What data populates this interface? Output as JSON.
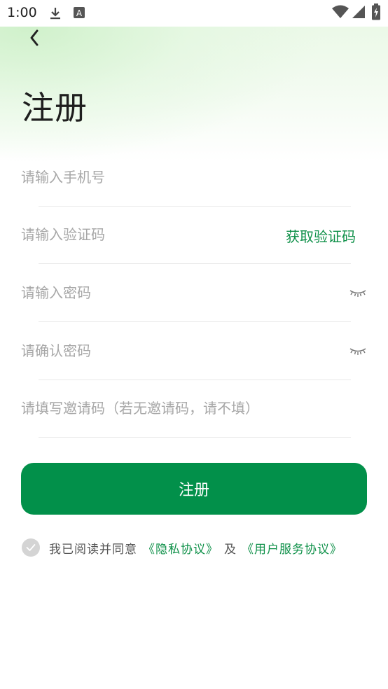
{
  "status_bar": {
    "time": "1:00",
    "icons": [
      "download-icon",
      "a-badge-icon",
      "wifi-icon",
      "signal-icon",
      "battery-icon"
    ]
  },
  "header": {
    "back_icon": "chevron-left-icon",
    "title": "注册"
  },
  "form": {
    "phone_placeholder": "请输入手机号",
    "code_placeholder": "请输入验证码",
    "get_code_label": "获取验证码",
    "password_placeholder": "请输入密码",
    "confirm_placeholder": "请确认密码",
    "invite_placeholder": "请填写邀请码（若无邀请码，请不填）",
    "eye_icon": "eye-closed-icon"
  },
  "register_button": "注册",
  "agreement": {
    "checked": true,
    "text": "我已阅读并同意",
    "privacy_link": "《隐私协议》",
    "and": "及",
    "service_link": "《用户服务协议》"
  },
  "colors": {
    "accent": "#02904a",
    "link": "#10914a",
    "placeholder": "#a7a7a7"
  }
}
